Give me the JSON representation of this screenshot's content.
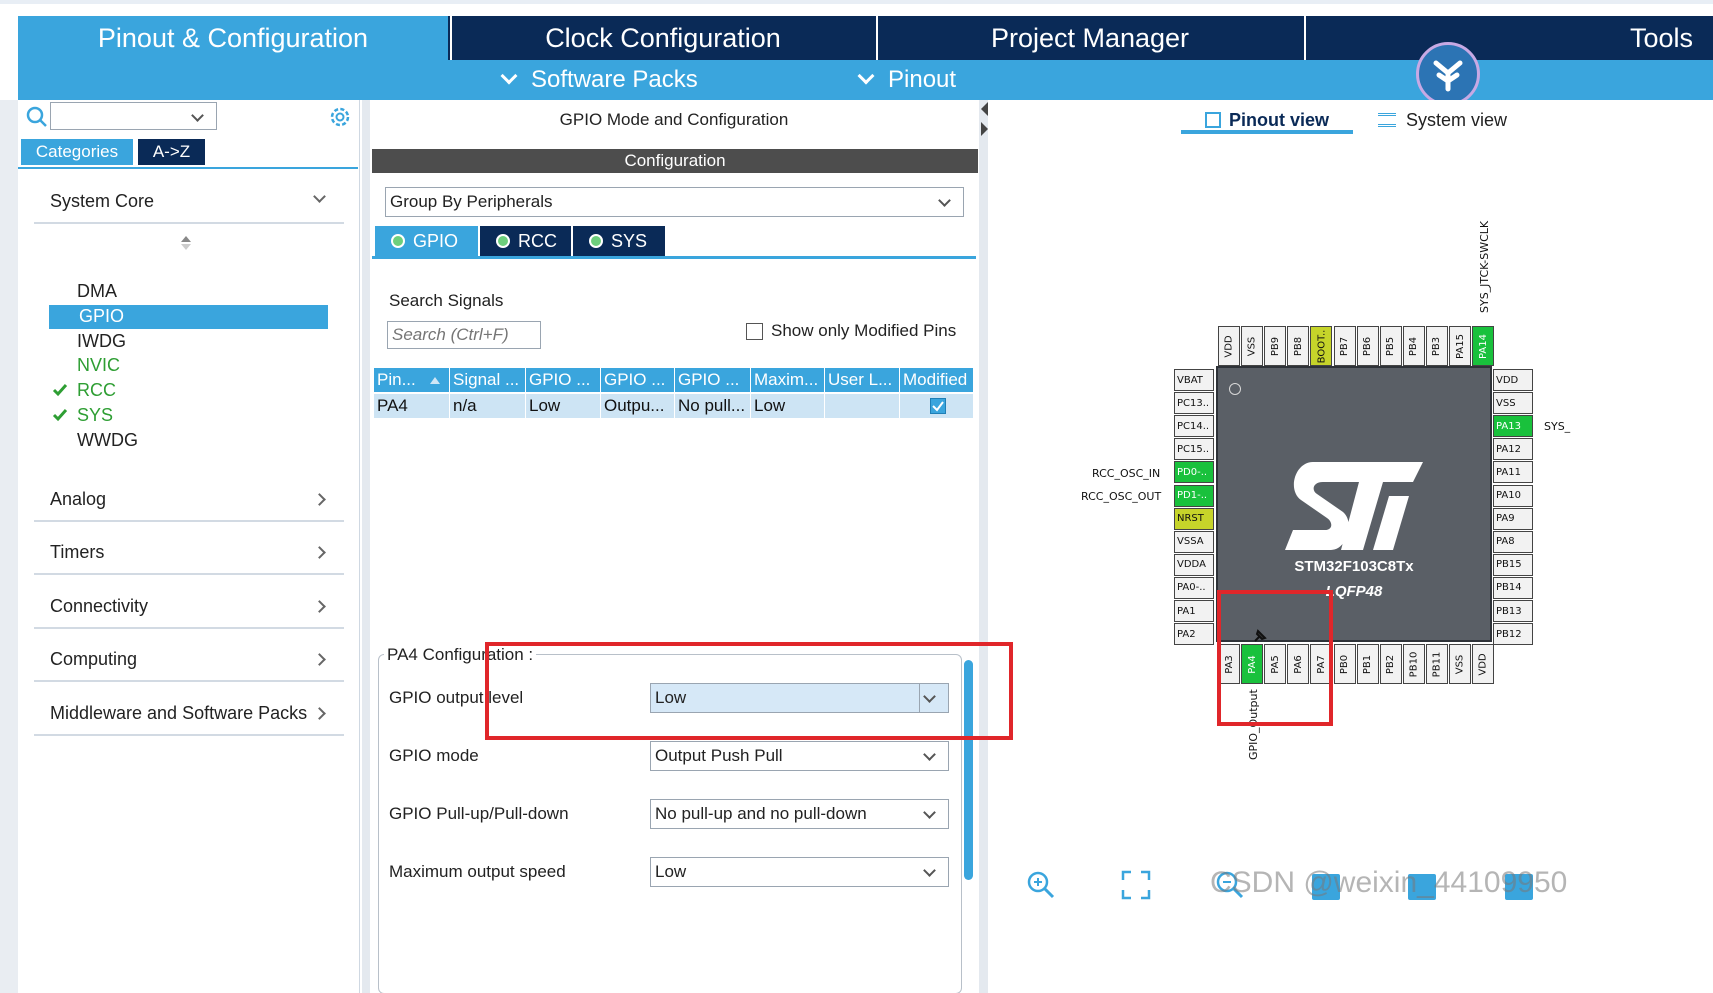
{
  "header": {
    "tabs": [
      {
        "label": "Pinout & Configuration",
        "active": true
      },
      {
        "label": "Clock Configuration",
        "active": false
      },
      {
        "label": "Project Manager",
        "active": false
      },
      {
        "label": "Tools",
        "active": false
      }
    ],
    "sub_items": [
      "Software Packs",
      "Pinout"
    ]
  },
  "left": {
    "search_value": "",
    "toggle": {
      "categories": "Categories",
      "az": "A->Z"
    },
    "system_core": {
      "label": "System Core",
      "items": [
        {
          "label": "DMA",
          "checked": false,
          "selected": false,
          "color": "#222222"
        },
        {
          "label": "GPIO",
          "checked": false,
          "selected": true,
          "color": "#ffffff"
        },
        {
          "label": "IWDG",
          "checked": false,
          "selected": false,
          "color": "#222222"
        },
        {
          "label": "NVIC",
          "checked": false,
          "selected": false,
          "color": "#2e9e33"
        },
        {
          "label": "RCC",
          "checked": true,
          "selected": false,
          "color": "#2e9e33"
        },
        {
          "label": "SYS",
          "checked": true,
          "selected": false,
          "color": "#2e9e33"
        },
        {
          "label": "WWDG",
          "checked": false,
          "selected": false,
          "color": "#222222"
        }
      ]
    },
    "sections": [
      "Analog",
      "Timers",
      "Connectivity",
      "Computing",
      "Middleware and Software Packs"
    ]
  },
  "middle": {
    "title": "GPIO Mode and Configuration",
    "config_header": "Configuration",
    "group_by": "Group By Peripherals",
    "peripheral_tabs": [
      "GPIO",
      "RCC",
      "SYS"
    ],
    "search_label": "Search Signals",
    "search_placeholder": "Search (Ctrl+F)",
    "show_modified": "Show only Modified Pins",
    "table": {
      "headers": [
        "Pin...",
        "Signal ...",
        "GPIO ...",
        "GPIO ...",
        "GPIO ...",
        "Maxim...",
        "User L...",
        "Modified"
      ],
      "rows": [
        {
          "cells": [
            "PA4",
            "n/a",
            "Low",
            "Outpu...",
            "No pull...",
            "Low",
            ""
          ],
          "modified": true
        }
      ]
    },
    "pin_config": {
      "legend": "PA4 Configuration :",
      "fields": [
        {
          "label": "GPIO output level",
          "value": "Low"
        },
        {
          "label": "GPIO mode",
          "value": "Output Push Pull"
        },
        {
          "label": "GPIO Pull-up/Pull-down",
          "value": "No pull-up and no pull-down"
        },
        {
          "label": "Maximum output speed",
          "value": "Low"
        }
      ]
    }
  },
  "right": {
    "view_tabs": [
      {
        "label": "Pinout view",
        "active": true
      },
      {
        "label": "System view",
        "active": false
      }
    ],
    "chip": {
      "name": "STM32F103C8Tx",
      "package": "LQFP48"
    },
    "top_pins": [
      "VDD",
      "VSS",
      "PB9",
      "PB8",
      "BOOT..",
      "PB7",
      "PB6",
      "PB5",
      "PB4",
      "PB3",
      "PA15",
      "PA14"
    ],
    "left_pins": [
      "VBAT",
      "PC13..",
      "PC14..",
      "PC15..",
      "PD0-..",
      "PD1-..",
      "NRST",
      "VSSA",
      "VDDA",
      "PA0-..",
      "PA1",
      "PA2"
    ],
    "right_pins": [
      "VDD",
      "VSS",
      "PA13",
      "PA12",
      "PA11",
      "PA10",
      "PA9",
      "PA8",
      "PB15",
      "PB14",
      "PB13",
      "PB12"
    ],
    "bottom_pins": [
      "PA3",
      "PA4",
      "PA5",
      "PA6",
      "PA7",
      "PB0",
      "PB1",
      "PB2",
      "PB10",
      "PB11",
      "VSS",
      "VDD"
    ],
    "signals": {
      "top_pa14": "SYS_JTCK-SWCLK",
      "right_pa13": "SYS_",
      "left_pd0": "RCC_OSC_IN",
      "left_pd1": "RCC_OSC_OUT",
      "bottom_pa4": "GPIO_Output"
    },
    "watermark": "CSDN @weixin_44109950"
  },
  "colors": {
    "dark_navy": "#0a2a57",
    "accent_blue": "#3aa5dd",
    "pin_green": "#19c13c",
    "pin_yellow": "#c6d42a",
    "highlight_red": "#e0262a"
  }
}
